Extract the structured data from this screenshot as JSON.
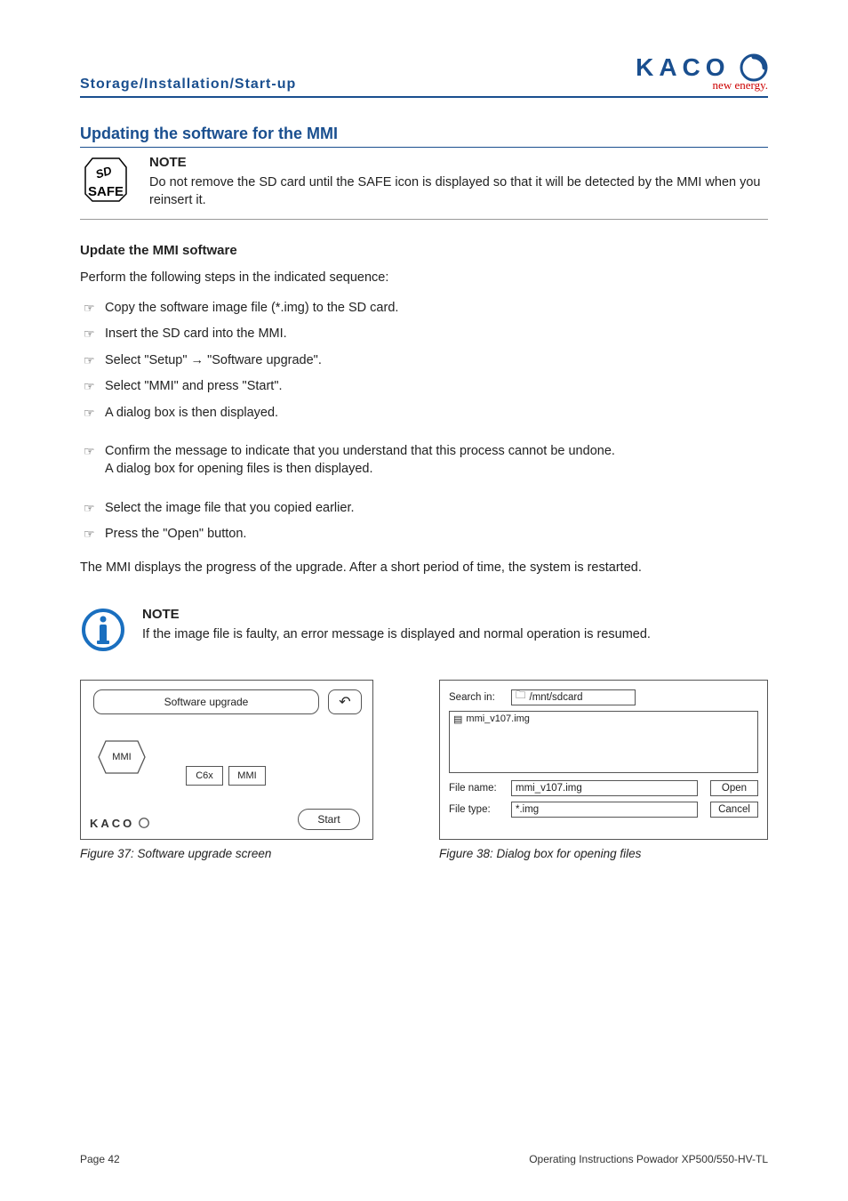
{
  "header": {
    "section": "Storage/Installation/Start-up",
    "logo_text": "KACO",
    "logo_tagline": "new energy."
  },
  "h2": "Updating the software for the MMI",
  "note1": {
    "title": "NOTE",
    "text": "Do not remove the SD card until the SAFE icon is displayed so that it will be detected by the MMI when you reinsert it."
  },
  "sd_label_top": "SD",
  "sd_label_bottom": "SAFE",
  "sub_heading": "Update the MMI software",
  "lead": "Perform the following steps in the indicated sequence:",
  "steps_a": [
    "Copy the software image file (*.img) to the SD card.",
    "Insert the SD card into the MMI.",
    "Select \"Setup\" → \"Software upgrade\".",
    "Select \"MMI\" and press \"Start\".",
    "A dialog box is then displayed."
  ],
  "steps_b": [
    "Confirm the message to indicate that you understand that this process cannot be undone."
  ],
  "steps_b_sub": "A dialog box for opening files is then displayed.",
  "steps_c": [
    "Select the image file that you copied earlier.",
    "Press the \"Open\" button."
  ],
  "closing": "The MMI displays the progress of the upgrade. After a short period of time, the system is restarted.",
  "note2": {
    "title": "NOTE",
    "text": "If the image file is faulty, an error message is displayed and normal operation is resumed."
  },
  "fig37": {
    "title_bar": "Software upgrade",
    "hex": "MMI",
    "cells": [
      "C6x",
      "MMI"
    ],
    "logo": "KACO",
    "start": "Start",
    "caption": "Figure 37:  Software upgrade screen"
  },
  "fig38": {
    "search_label": "Search in:",
    "search_value": "/mnt/sdcard",
    "file_item": "mmi_v107.img",
    "filename_label": "File name:",
    "filename_value": "mmi_v107.img",
    "filetype_label": "File type:",
    "filetype_value": "*.img",
    "open_btn": "Open",
    "cancel_btn": "Cancel",
    "caption": "Figure 38:  Dialog box for opening files"
  },
  "footer": {
    "page": "Page 42",
    "doc": "Operating Instructions Powador XP500/550-HV-TL"
  }
}
